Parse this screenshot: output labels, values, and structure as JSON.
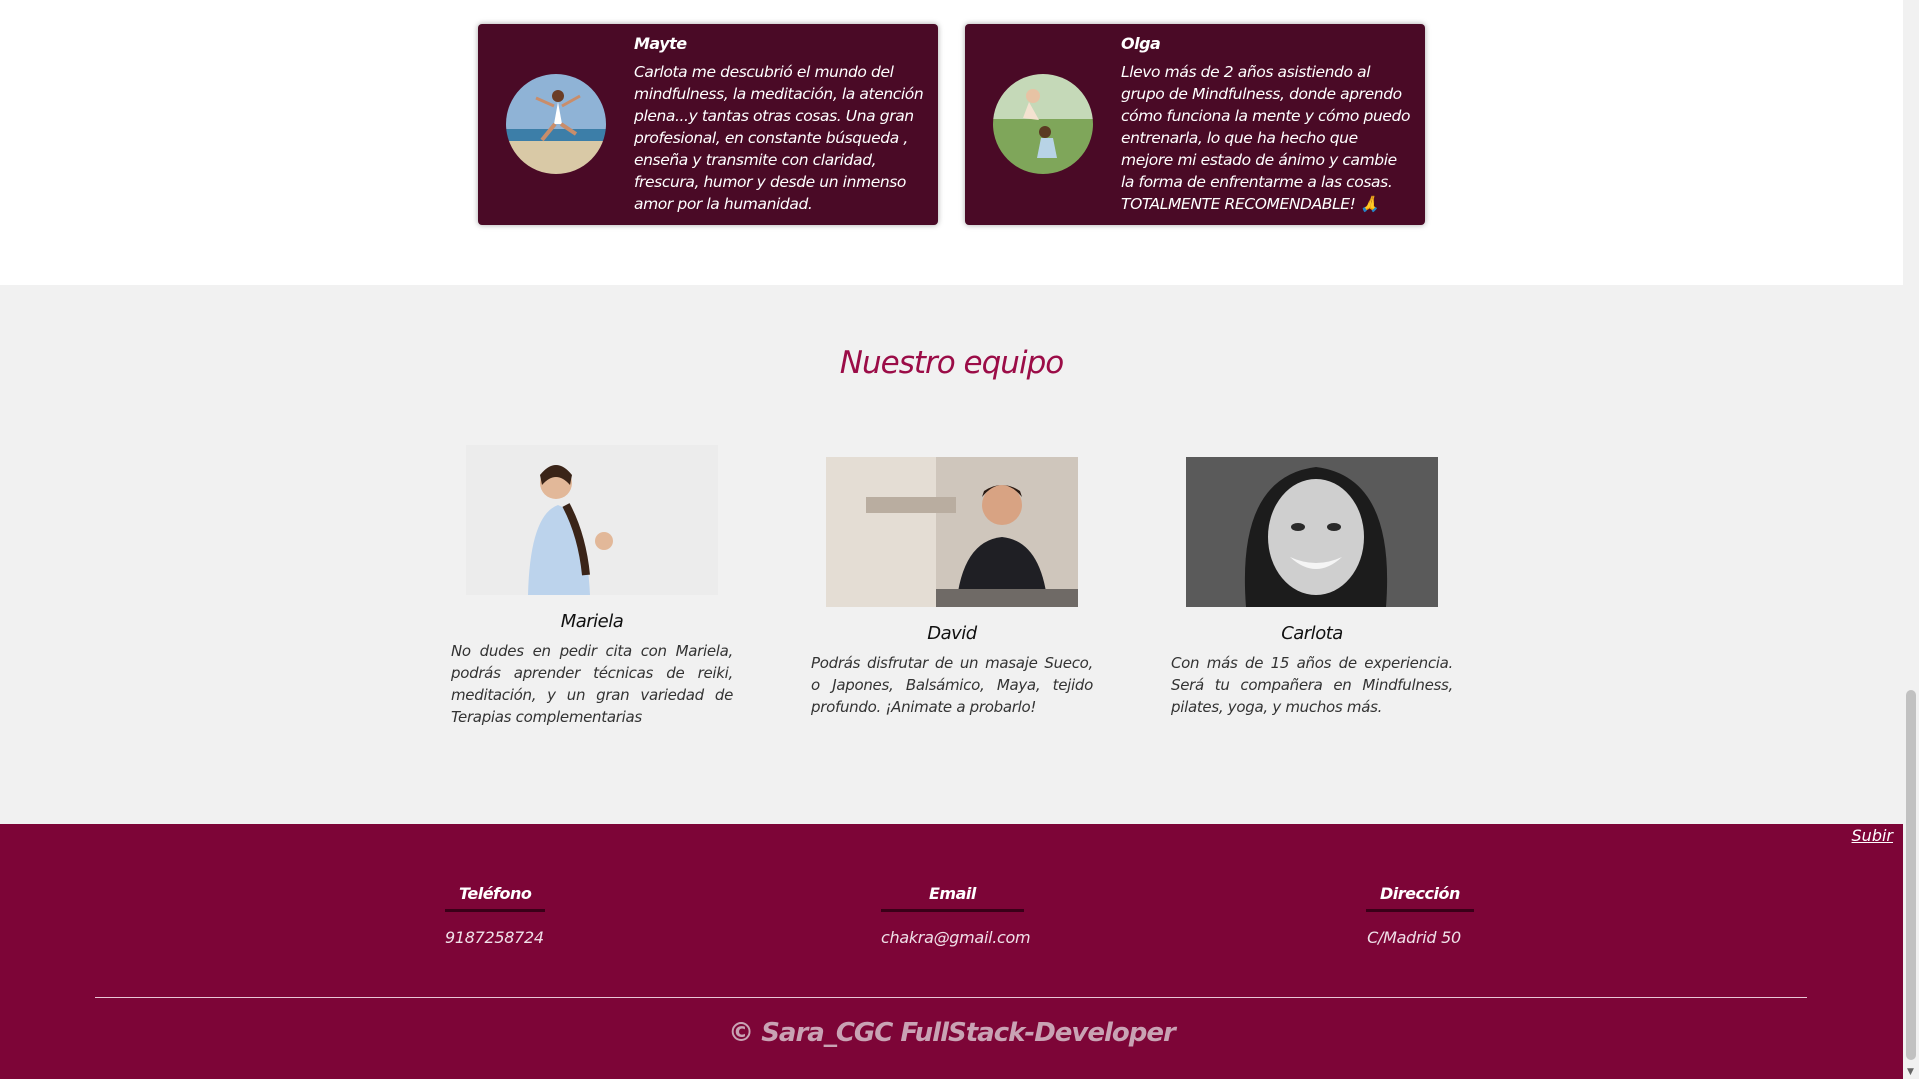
{
  "testimonials": [
    {
      "name": "Mayte",
      "text": "Carlota me descubrió el mundo del mindfulness, la meditación, la atención plena...y tantas otras cosas. Una gran profesional, en constante búsqueda , enseña y transmite con claridad, frescura, humor y desde un inmenso amor por la humanidad.",
      "avatar": "jumping-woman-beach-photo"
    },
    {
      "name": "Olga",
      "text": "Llevo más de 2 años asistiendo al grupo de Mindfulness, donde aprendo cómo funciona la mente y cómo puedo entrenarla, lo que ha hecho que mejore mi estado de ánimo y cambie la forma de enfrentarme a las cosas. TOTALMENTE RECOMENDABLE! 🙏",
      "avatar": "mother-child-park-photo"
    }
  ],
  "team": {
    "title": "Nuestro equipo",
    "members": [
      {
        "name": "Mariela",
        "description": "No dudes en pedir cita con Mariela, podrás aprender técnicas de reiki, meditación, y un gran variedad de Terapias complementarias",
        "photo": "woman-thumbs-up-photo"
      },
      {
        "name": "David",
        "description": "Podrás disfrutar de un masaje Sueco, o Japones, Balsámico, Maya, tejido profundo. ¡Animate a probarlo!",
        "photo": "man-massage-studio-photo"
      },
      {
        "name": "Carlota",
        "description": "Con más de 15 años de experiencia. Será tu compañera en Mindfulness, pilates, yoga, y muchos más.",
        "photo": "smiling-woman-bw-photo"
      }
    ]
  },
  "footer": {
    "scroll_top_label": "Subir",
    "columns": [
      {
        "heading": "Teléfono",
        "value": "9187258724"
      },
      {
        "heading": "Email",
        "value": "chakra@gmail.com"
      },
      {
        "heading": "Dirección",
        "value": "C/Madrid 50"
      }
    ],
    "copyright": "© Sara_CGC FullStack-Developer"
  },
  "colors": {
    "card_bg": "#4a0a26",
    "accent": "#9b0c47",
    "footer_bg": "#7d0537",
    "team_bg": "#f1f1f1"
  }
}
